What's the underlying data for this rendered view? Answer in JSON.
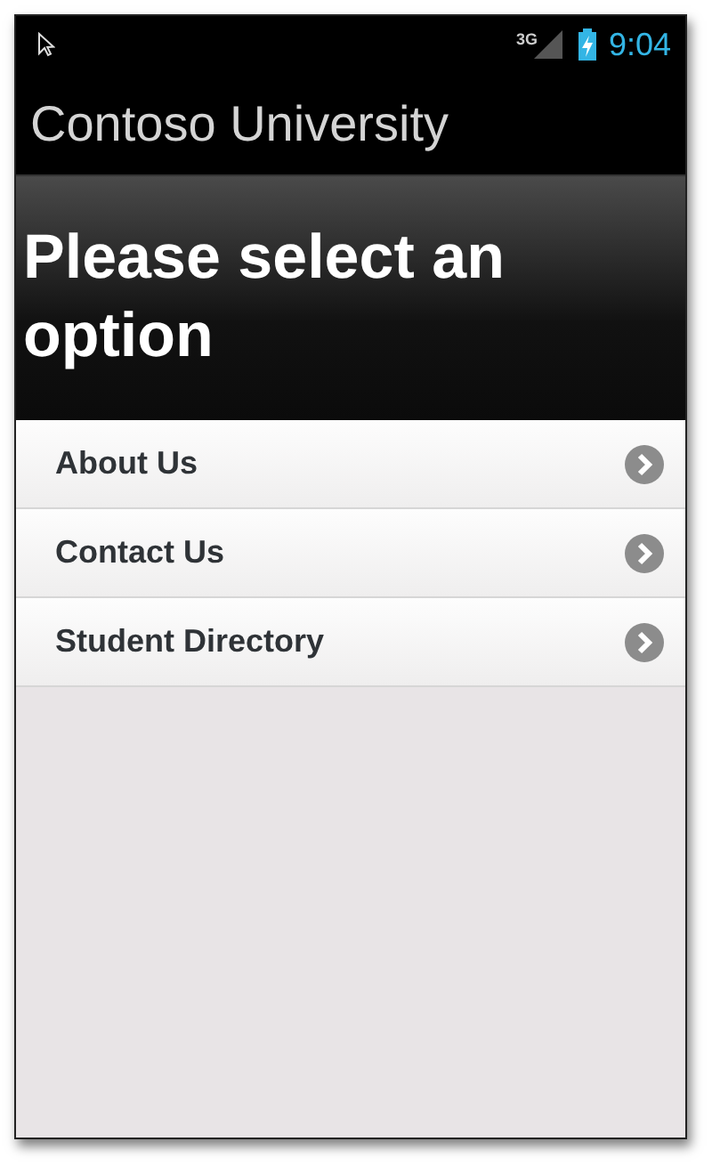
{
  "status_bar": {
    "network": "3G",
    "time": "9:04"
  },
  "app_bar": {
    "title": "Contoso University"
  },
  "header": {
    "title": "Please select an option"
  },
  "menu": {
    "items": [
      {
        "label": "About Us"
      },
      {
        "label": "Contact Us"
      },
      {
        "label": "Student Directory"
      }
    ]
  }
}
